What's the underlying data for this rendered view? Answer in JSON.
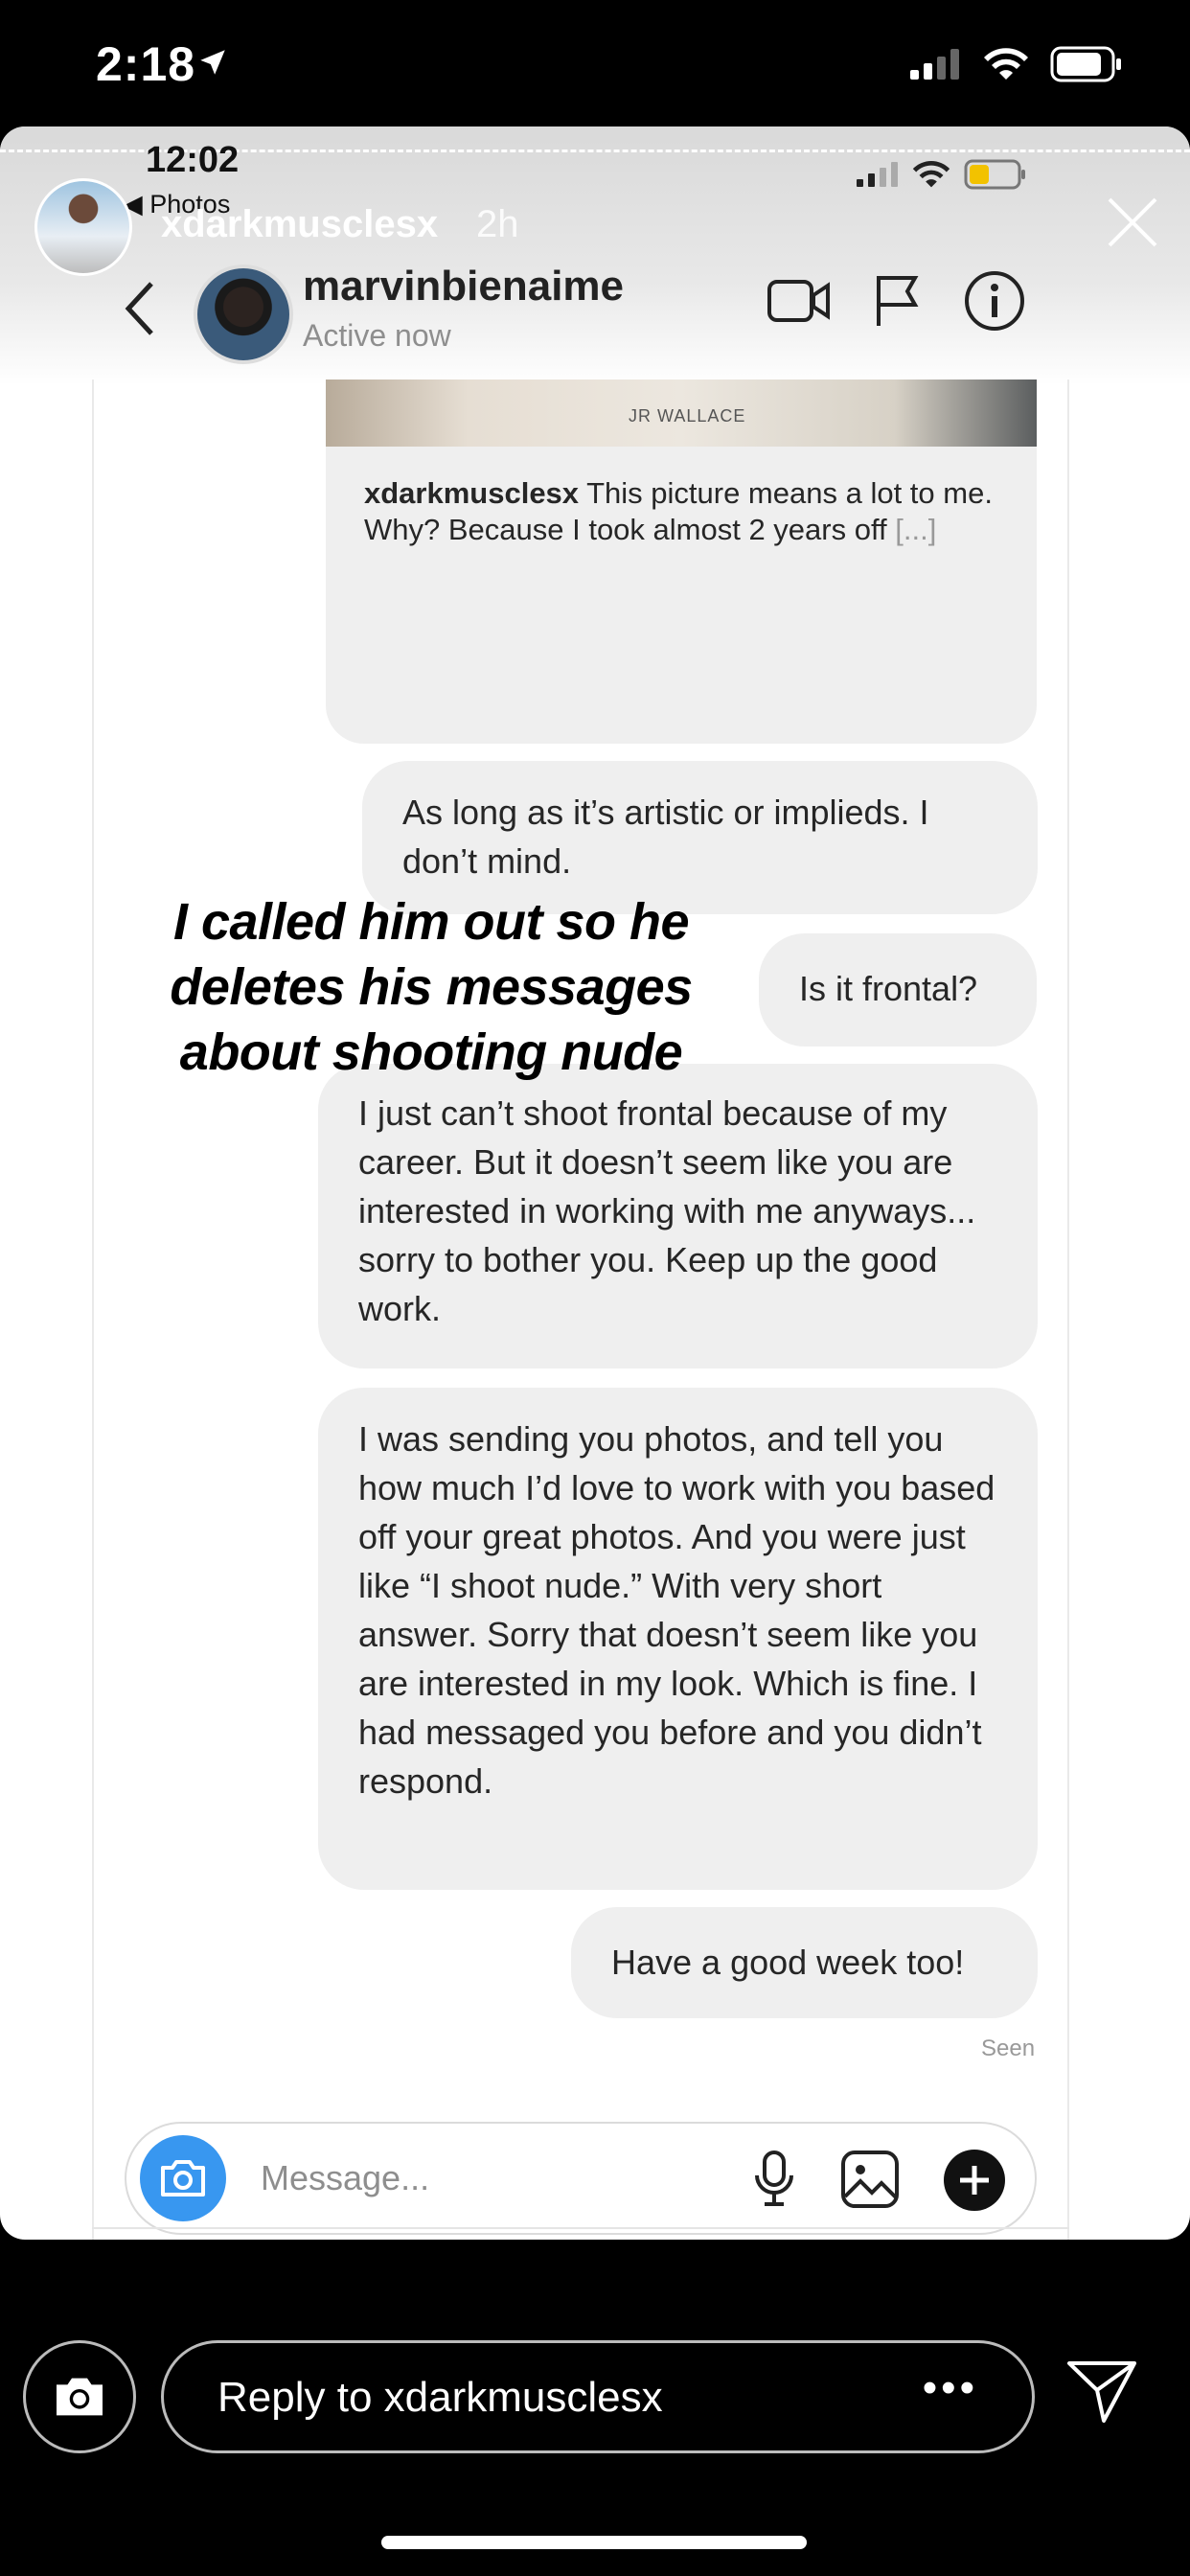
{
  "status_bar": {
    "time": "2:18"
  },
  "story": {
    "username": "xdarkmusclesx",
    "age": "2h",
    "inner_status": {
      "time": "12:02",
      "back_app": "◀ Photos"
    },
    "overlay_text": "I called him out so he deletes his messages about shooting nude"
  },
  "chat": {
    "name": "marvinbienaime",
    "status": "Active now",
    "shared_post": {
      "watermark": "JR WALLACE",
      "author": "xdarkmusclesx",
      "caption": " This picture means a lot to me. Why? Because I took almost 2 years off ",
      "more": "[...]"
    },
    "messages": [
      {
        "text": "As long as it’s artistic or implieds. I don’t mind."
      },
      {
        "text": "Is it frontal?"
      },
      {
        "text": "I just can’t shoot frontal because of my career. But it doesn’t seem like you are interested in working with me anyways... sorry to bother you. Keep up the good work."
      },
      {
        "text": "I was sending you photos, and tell you how much I’d love to work with you based off your great photos. And you were just like “I shoot nude.” With very short answer. Sorry that doesn’t seem like you are interested in my look. Which is fine. I had messaged you before and you didn’t respond."
      },
      {
        "text": "Have a good week too!"
      }
    ],
    "seen_label": "Seen",
    "composer_placeholder": "Message..."
  },
  "reply_bar": {
    "placeholder": "Reply to xdarkmusclesx",
    "more": "•••"
  },
  "colors": {
    "accent_blue": "#3897f0",
    "bubble_gray": "#efefef"
  }
}
